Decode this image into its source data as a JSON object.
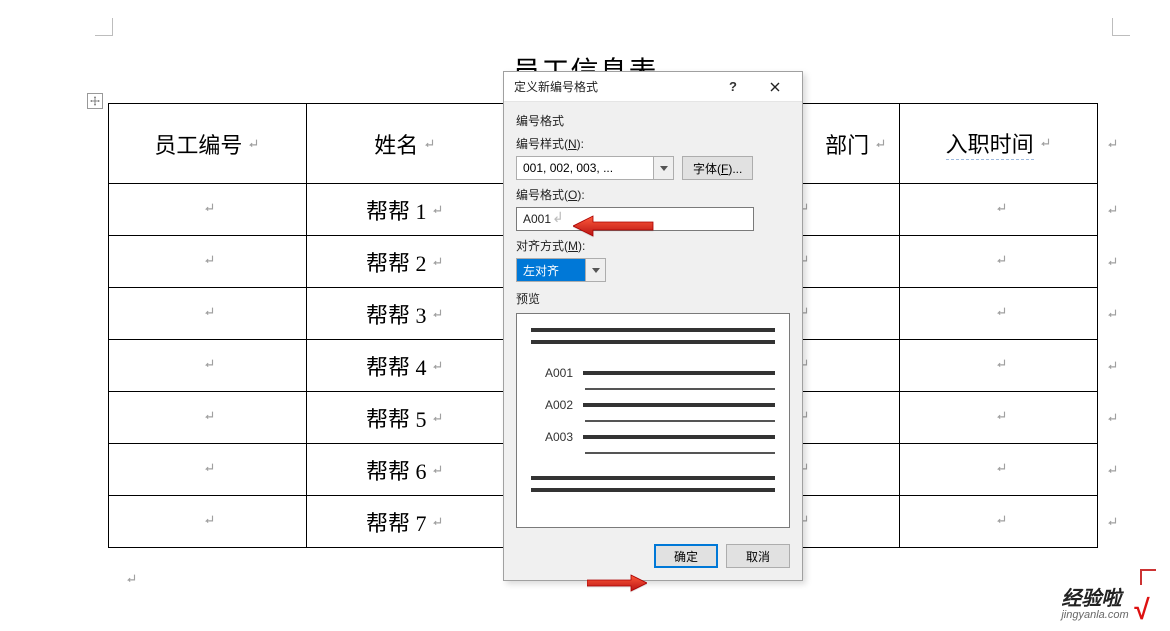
{
  "document": {
    "title": "员工信息表",
    "headers": {
      "col1": "员工编号",
      "col2": "姓名",
      "col3_suffix": "部门",
      "col5": "入职时间"
    },
    "rows": [
      {
        "name": "帮帮 1"
      },
      {
        "name": "帮帮 2"
      },
      {
        "name": "帮帮 3"
      },
      {
        "name": "帮帮 4"
      },
      {
        "name": "帮帮 5"
      },
      {
        "name": "帮帮 6"
      },
      {
        "name": "帮帮 7"
      }
    ]
  },
  "dialog": {
    "title": "定义新编号格式",
    "group_label": "编号格式",
    "number_style_label": "编号样式(N):",
    "number_style_value": "001, 002, 003, ...",
    "font_button": "字体(F)...",
    "number_format_label": "编号格式(O):",
    "number_format_value": "A001",
    "alignment_label": "对齐方式(M):",
    "alignment_value": "左对齐",
    "preview_label": "预览",
    "preview_items": [
      "A001",
      "A002",
      "A003"
    ],
    "ok_button": "确定",
    "cancel_button": "取消",
    "help_button": "?"
  },
  "watermark": {
    "line1_cn": "经验啦",
    "line2_en": "jingyanla.com"
  }
}
